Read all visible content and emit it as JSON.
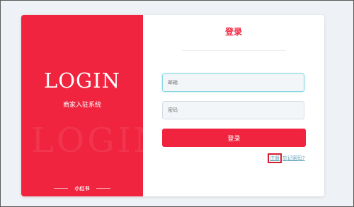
{
  "left_panel": {
    "login_title": "LOGIN",
    "subtitle": "商家入驻系统",
    "watermark": "LOGIN",
    "brand": "小红书"
  },
  "form": {
    "title": "登录",
    "email_placeholder": "邮箱",
    "password_placeholder": "密码",
    "submit_label": "登录",
    "register_label": "注册",
    "forgot_label": "忘记密码?"
  },
  "colors": {
    "accent": "#f0243f",
    "link": "#5d9eb5",
    "page_background": "#eef1f5",
    "field_background": "#f3f6f9",
    "highlight_box": "#d61f2f"
  }
}
